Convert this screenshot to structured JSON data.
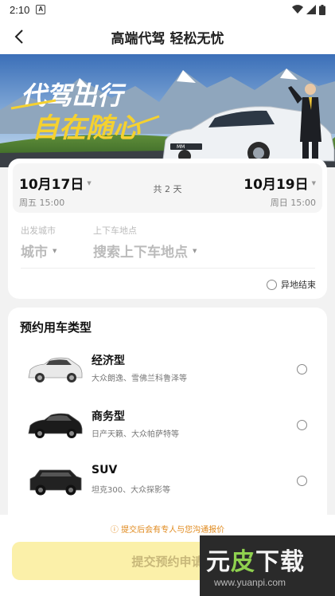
{
  "status_bar": {
    "time": "2:10",
    "badge": "A"
  },
  "nav": {
    "title": "高端代驾 轻松无忧"
  },
  "banner": {
    "headline_line1": "代驾出行",
    "headline_line2": "自在随心",
    "plate": "MM"
  },
  "trip": {
    "start_date": "10月17日",
    "start_time": "周五 15:00",
    "duration": "共 2 天",
    "end_date": "10月19日",
    "end_time": "周日 15:00",
    "city_label": "出发城市",
    "city_value": "城市",
    "location_label": "上下车地点",
    "location_value": "搜索上下车地点",
    "offsite_label": "异地结束"
  },
  "car_types": {
    "heading": "预约用车类型",
    "items": [
      {
        "name": "经济型",
        "desc": "大众朗逸、雪佛兰科鲁泽等",
        "color": "#e9e9e9"
      },
      {
        "name": "商务型",
        "desc": "日产天籁、大众帕萨特等",
        "color": "#1b1b1b"
      },
      {
        "name": "SUV",
        "desc": "坦克300、大众探影等",
        "color": "#222222"
      }
    ]
  },
  "footer": {
    "notice": "提交后会有专人与您沟通报价",
    "submit_label": "提交预约申请"
  },
  "watermark": {
    "logo_a": "元",
    "logo_b": "皮",
    "logo_c": "下载",
    "url": "www.yuanpi.com"
  },
  "colors": {
    "accent": "#fbf0a9",
    "notice": "#e08a1e",
    "headline_yellow": "#f5d130"
  }
}
